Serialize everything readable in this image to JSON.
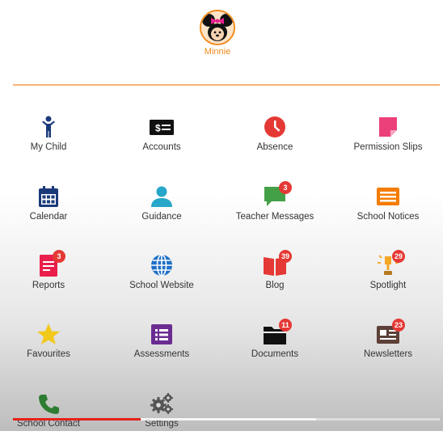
{
  "profile": {
    "name": "Minnie",
    "accent": "#f08a1c"
  },
  "tiles": [
    {
      "label": "My Child",
      "icon": "child-icon",
      "color": "#1a3a7a"
    },
    {
      "label": "Accounts",
      "icon": "money-icon",
      "color": "#111111"
    },
    {
      "label": "Absence",
      "icon": "clock-icon",
      "color": "#e53935"
    },
    {
      "label": "Permission Slips",
      "icon": "note-icon",
      "color": "#ec407a"
    },
    {
      "label": "Calendar",
      "icon": "calendar-icon",
      "color": "#1a3a7a"
    },
    {
      "label": "Guidance",
      "icon": "person-icon",
      "color": "#26a6c9"
    },
    {
      "label": "Teacher Messages",
      "icon": "message-icon",
      "color": "#43a047",
      "badge": "3"
    },
    {
      "label": "School Notices",
      "icon": "notice-icon",
      "color": "#f57c00"
    },
    {
      "label": "Reports",
      "icon": "report-icon",
      "color": "#e91e4a",
      "badge": "3"
    },
    {
      "label": "School Website",
      "icon": "globe-icon",
      "color": "#1e6fc8"
    },
    {
      "label": "Blog",
      "icon": "book-icon",
      "color": "#e53935",
      "badge": "39"
    },
    {
      "label": "Spotlight",
      "icon": "spotlight-icon",
      "color": "#f5a623",
      "badge": "29"
    },
    {
      "label": "Favourites",
      "icon": "star-icon",
      "color": "#f2c81a"
    },
    {
      "label": "Assessments",
      "icon": "list-icon",
      "color": "#6a2c91"
    },
    {
      "label": "Documents",
      "icon": "folder-icon",
      "color": "#111111",
      "badge": "11"
    },
    {
      "label": "Newsletters",
      "icon": "newspaper-icon",
      "color": "#5d4037",
      "badge": "23"
    },
    {
      "label": "School Contact",
      "icon": "phone-icon",
      "color": "#2e7d32"
    },
    {
      "label": "Settings",
      "icon": "gears-icon",
      "color": "#555555"
    }
  ],
  "video_progress": {
    "played": 0.3,
    "buffered": 0.71
  }
}
